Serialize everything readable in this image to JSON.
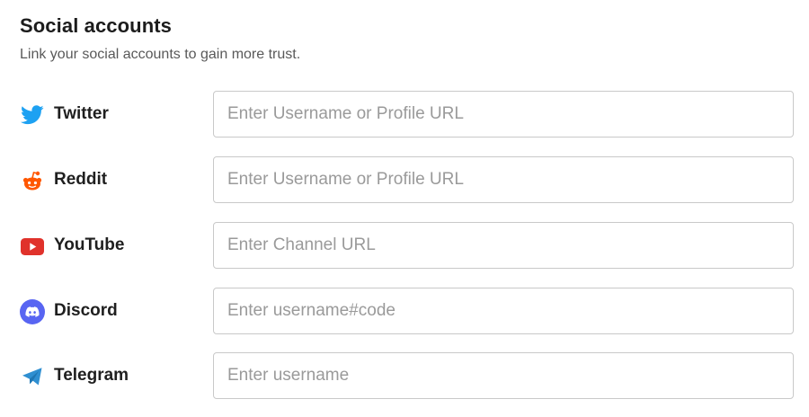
{
  "header": {
    "title": "Social accounts",
    "subtitle": "Link your social accounts to gain more trust."
  },
  "accounts": [
    {
      "label": "Twitter",
      "icon": "twitter-icon",
      "color": "#1DA1F2",
      "placeholder": "Enter Username or Profile URL",
      "value": ""
    },
    {
      "label": "Reddit",
      "icon": "reddit-icon",
      "color": "#FF5700",
      "placeholder": "Enter Username or Profile URL",
      "value": ""
    },
    {
      "label": "YouTube",
      "icon": "youtube-icon",
      "color": "#E0322B",
      "placeholder": "Enter Channel URL",
      "value": ""
    },
    {
      "label": "Discord",
      "icon": "discord-icon",
      "color": "#5865F2",
      "placeholder": "Enter username#code",
      "value": ""
    },
    {
      "label": "Telegram",
      "icon": "telegram-icon",
      "color": "#2F8FD1",
      "placeholder": "Enter username",
      "value": ""
    }
  ]
}
